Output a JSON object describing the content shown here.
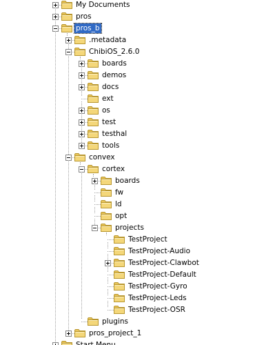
{
  "tree": {
    "selected": "pros_b",
    "nodes": [
      {
        "id": "my-documents",
        "label": "My Documents",
        "depth": 0,
        "toggle": "plus",
        "open": false
      },
      {
        "id": "pros",
        "label": "pros",
        "depth": 0,
        "toggle": "plus",
        "open": false
      },
      {
        "id": "pros-b",
        "label": "pros_b",
        "depth": 0,
        "toggle": "minus",
        "open": true,
        "selected": true
      },
      {
        "id": "metadata",
        "label": ".metadata",
        "depth": 1,
        "toggle": "plus",
        "open": false
      },
      {
        "id": "chibios",
        "label": "ChibiOS_2.6.0",
        "depth": 1,
        "toggle": "minus",
        "open": true
      },
      {
        "id": "chibios-boards",
        "label": "boards",
        "depth": 2,
        "toggle": "plus",
        "open": false
      },
      {
        "id": "chibios-demos",
        "label": "demos",
        "depth": 2,
        "toggle": "plus",
        "open": false
      },
      {
        "id": "chibios-docs",
        "label": "docs",
        "depth": 2,
        "toggle": "plus",
        "open": false
      },
      {
        "id": "chibios-ext",
        "label": "ext",
        "depth": 2,
        "toggle": "none",
        "open": false
      },
      {
        "id": "chibios-os",
        "label": "os",
        "depth": 2,
        "toggle": "plus",
        "open": false
      },
      {
        "id": "chibios-test",
        "label": "test",
        "depth": 2,
        "toggle": "plus",
        "open": false
      },
      {
        "id": "chibios-testhal",
        "label": "testhal",
        "depth": 2,
        "toggle": "plus",
        "open": false
      },
      {
        "id": "chibios-tools",
        "label": "tools",
        "depth": 2,
        "toggle": "plus",
        "open": false
      },
      {
        "id": "convex",
        "label": "convex",
        "depth": 1,
        "toggle": "minus",
        "open": true
      },
      {
        "id": "cortex",
        "label": "cortex",
        "depth": 2,
        "toggle": "minus",
        "open": true
      },
      {
        "id": "cortex-boards",
        "label": "boards",
        "depth": 3,
        "toggle": "plus",
        "open": false
      },
      {
        "id": "cortex-fw",
        "label": "fw",
        "depth": 3,
        "toggle": "none",
        "open": false
      },
      {
        "id": "cortex-ld",
        "label": "ld",
        "depth": 3,
        "toggle": "none",
        "open": false
      },
      {
        "id": "cortex-opt",
        "label": "opt",
        "depth": 3,
        "toggle": "none",
        "open": false
      },
      {
        "id": "projects",
        "label": "projects",
        "depth": 3,
        "toggle": "minus",
        "open": true
      },
      {
        "id": "testproject",
        "label": "TestProject",
        "depth": 4,
        "toggle": "none",
        "open": false
      },
      {
        "id": "testproject-audio",
        "label": "TestProject-Audio",
        "depth": 4,
        "toggle": "none",
        "open": false
      },
      {
        "id": "testproject-clawbot",
        "label": "TestProject-Clawbot",
        "depth": 4,
        "toggle": "plus",
        "open": false
      },
      {
        "id": "testproject-default",
        "label": "TestProject-Default",
        "depth": 4,
        "toggle": "none",
        "open": false
      },
      {
        "id": "testproject-gyro",
        "label": "TestProject-Gyro",
        "depth": 4,
        "toggle": "none",
        "open": false
      },
      {
        "id": "testproject-leds",
        "label": "TestProject-Leds",
        "depth": 4,
        "toggle": "none",
        "open": false
      },
      {
        "id": "testproject-osr",
        "label": "TestProject-OSR",
        "depth": 4,
        "toggle": "none",
        "open": false
      },
      {
        "id": "plugins",
        "label": "plugins",
        "depth": 2,
        "toggle": "none",
        "open": false
      },
      {
        "id": "pros-project-1",
        "label": "pros_project_1",
        "depth": 1,
        "toggle": "plus",
        "open": false
      },
      {
        "id": "start-menu",
        "label": "Start Menu",
        "depth": 0,
        "toggle": "plus",
        "open": false
      }
    ]
  },
  "colors": {
    "folder_fill": "#f4d77a",
    "folder_tab": "#e8c45a",
    "folder_outline": "#b8962e",
    "selection": "#316ac5",
    "guide": "#a0a0a0"
  }
}
